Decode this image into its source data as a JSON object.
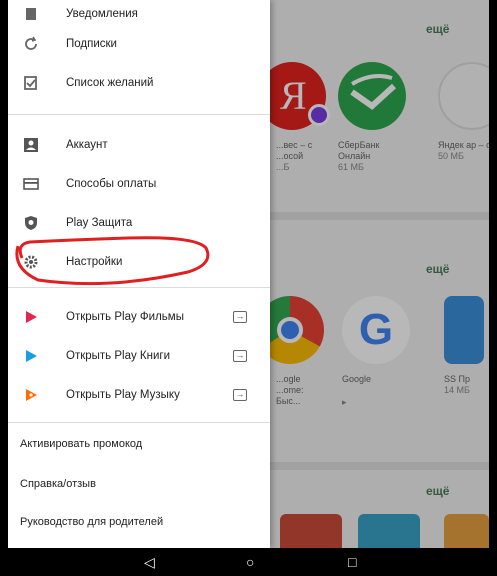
{
  "drawer": {
    "items": [
      {
        "label": "Уведомления",
        "icon": "bell-icon"
      },
      {
        "label": "Подписки",
        "icon": "refresh-icon"
      },
      {
        "label": "Список желаний",
        "icon": "bookmark-check-icon"
      },
      {
        "label": "Аккаунт",
        "icon": "account-box-icon"
      },
      {
        "label": "Способы оплаты",
        "icon": "credit-card-icon"
      },
      {
        "label": "Play Защита",
        "icon": "shield-icon"
      },
      {
        "label": "Настройки",
        "icon": "gear-icon"
      },
      {
        "label": "Открыть Play Фильмы",
        "icon": "play-movies-icon"
      },
      {
        "label": "Открыть Play Книги",
        "icon": "play-books-icon"
      },
      {
        "label": "Открыть Play Музыку",
        "icon": "play-music-icon"
      }
    ],
    "footer": [
      "Активировать промокод",
      "Справка/отзыв",
      "Руководство для родителей"
    ]
  },
  "background": {
    "more_label": "ещё",
    "row1": [
      {
        "name": "...вес – с ...осой",
        "size": "...Б"
      },
      {
        "name": "СберБанк Онлайн",
        "size": "61 МБ"
      },
      {
        "name": "Яндек ар – с",
        "size": "50 МБ"
      }
    ],
    "row2": [
      {
        "name": "...ogle ...ome: Быс...",
        "size": ""
      },
      {
        "name": "Google",
        "size": ""
      },
      {
        "name": "SS Пр",
        "size": "14 МБ"
      }
    ]
  },
  "navbar": {
    "back": "◁",
    "home": "○",
    "recents": "□"
  },
  "colors": {
    "highlight_circle": "#e02020",
    "accent_green": "#4a7d5a"
  }
}
